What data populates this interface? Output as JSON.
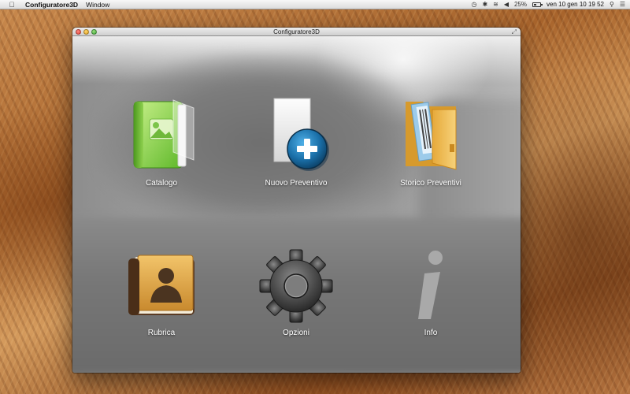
{
  "menubar": {
    "app_name": "Configuratore3D",
    "menus": [
      "Window"
    ],
    "status": {
      "battery_percent": "25%",
      "datetime": "ven 10 gen  10 19 52"
    }
  },
  "window": {
    "title": "Configuratore3D"
  },
  "items": [
    {
      "label": "Catalogo",
      "icon": "catalog-book-icon"
    },
    {
      "label": "Nuovo Preventivo",
      "icon": "new-document-plus-icon"
    },
    {
      "label": "Storico Preventivi",
      "icon": "folder-icon"
    },
    {
      "label": "Rubrica",
      "icon": "address-book-icon"
    },
    {
      "label": "Opzioni",
      "icon": "gear-icon"
    },
    {
      "label": "Info",
      "icon": "info-icon"
    }
  ],
  "colors": {
    "catalog_green": "#8fd14f",
    "plus_blue": "#1a6fa8",
    "folder_yellow": "#f2c14e",
    "book_brown": "#5a3a22",
    "gear_dark": "#3a3a3a"
  }
}
